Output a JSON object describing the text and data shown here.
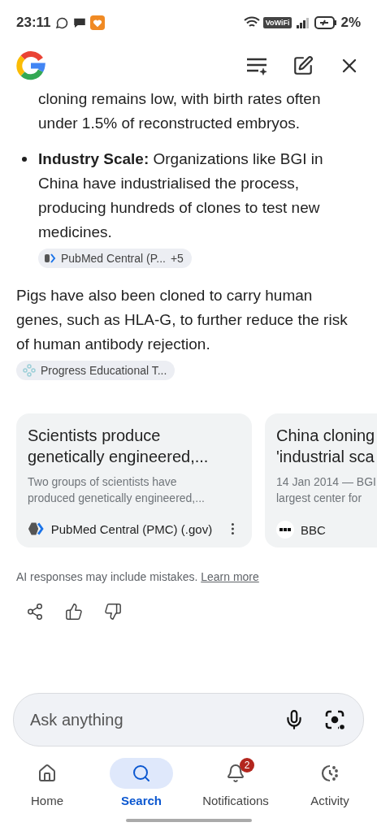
{
  "status_bar": {
    "time": "23:11",
    "wifi_badge": "VoWiFi",
    "battery": "2%"
  },
  "answer": {
    "items": [
      {
        "kind": "continuation",
        "text": "cloning remains low, with birth rates often under 1.5% of reconstructed embryos."
      },
      {
        "kind": "bullet",
        "text": "**Industry Scale:** Organizations like BGI in China have industrialised the process, producing hundreds of clones to test new medicines.",
        "source_chip": {
          "label": "PubMed Central (P...",
          "count": "+5"
        }
      }
    ],
    "paragraph": {
      "text": "Pigs have also been cloned to carry human genes, such as HLA-G, to further reduce the risk of human antibody rejection.",
      "source_chip": {
        "label": "Progress Educational T..."
      }
    }
  },
  "source_cards": [
    {
      "title_lines": [
        "Scientists produce",
        "genetically engineered,..."
      ],
      "snippet_lines": [
        "Two groups of scientists have",
        "produced genetically engineered,..."
      ],
      "source": "PubMed Central (PMC) (.gov)",
      "kind": "pmc"
    },
    {
      "title_lines": [
        "China cloning",
        "'industrial sca"
      ],
      "snippet_lines": [
        "14 Jan 2014 — BGI",
        "largest center for"
      ],
      "source": "BBC",
      "kind": "bbc"
    }
  ],
  "disclaimer": {
    "text": "AI responses may include mistakes.",
    "link": "Learn more"
  },
  "ask_field": {
    "placeholder": "Ask anything"
  },
  "bottom_nav": [
    {
      "label": "Home",
      "selected": false
    },
    {
      "label": "Search",
      "selected": true
    },
    {
      "label": "Notifications",
      "selected": false,
      "badge": "2"
    },
    {
      "label": "Activity",
      "selected": false
    }
  ]
}
